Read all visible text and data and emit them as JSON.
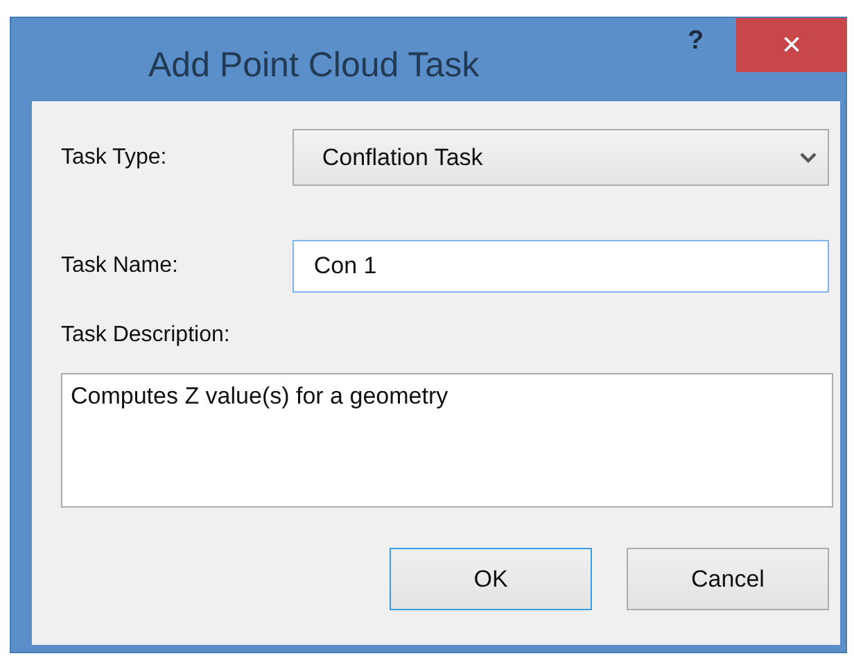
{
  "window": {
    "title": "Add Point Cloud Task",
    "help": "?",
    "close": "×"
  },
  "task_type": {
    "label": "Task Type:",
    "value": "Conflation Task"
  },
  "task_name": {
    "label": "Task Name:",
    "value": "Con 1"
  },
  "task_description": {
    "label": "Task Description:",
    "value": "Computes Z value(s) for a geometry"
  },
  "buttons": [
    {
      "label": "OK",
      "default": true
    },
    {
      "label": "Cancel",
      "default": false
    }
  ]
}
